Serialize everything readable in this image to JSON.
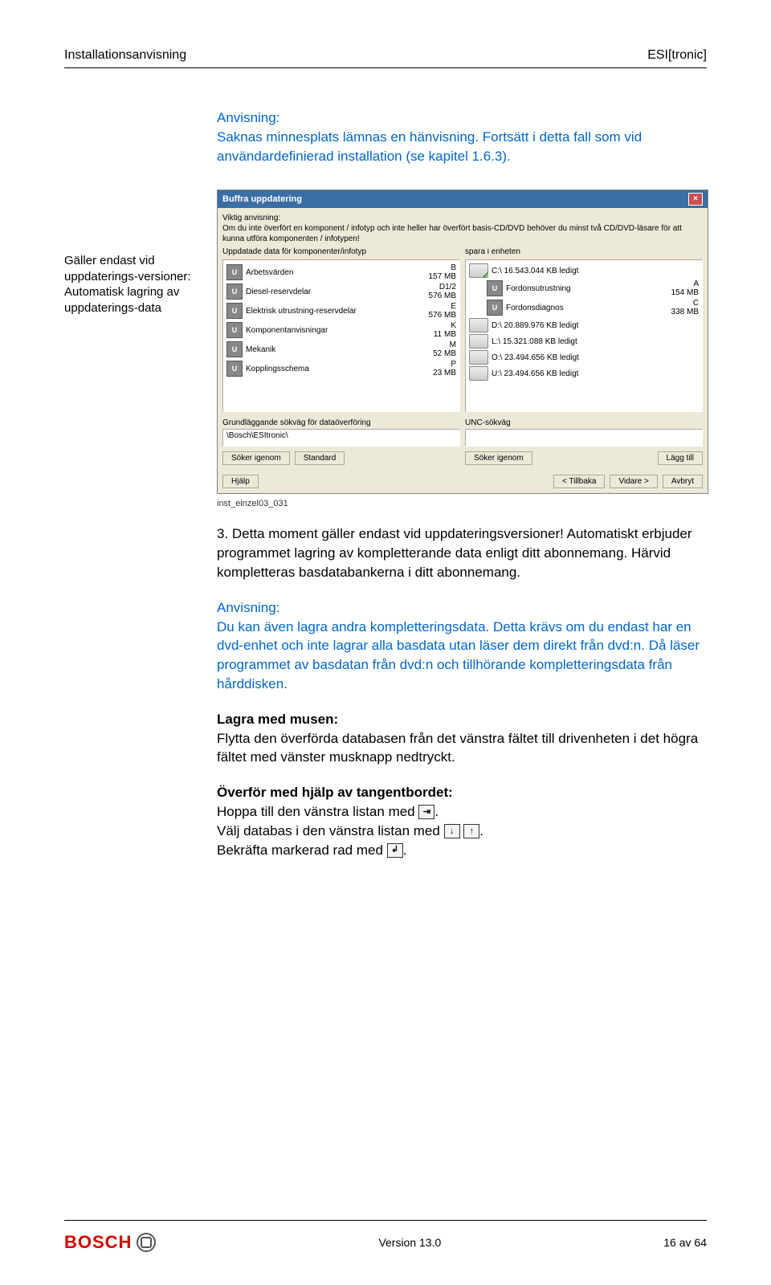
{
  "header": {
    "left": "Installationsanvisning",
    "right": "ESI[tronic]"
  },
  "intro": {
    "heading": "Anvisning:",
    "body": "Saknas minnesplats lämnas en hänvisning. Fortsätt i detta fall som vid användardefinierad installation (se kapitel 1.6.3)."
  },
  "sidenote": "Gäller endast vid uppdaterings-versioner: Automatisk lagring av uppdaterings-data",
  "dialog": {
    "title": "Buffra uppdatering",
    "intro_label": "Viktig anvisning:",
    "intro_body": "Om du inte överfört en komponent / infotyp och inte heller har överfört basis-CD/DVD behöver du minst två CD/DVD-läsare för att kunna utföra komponenten / infotypen!",
    "left_header": "Uppdatade data för komponenter/infotyp",
    "right_header": "spara i enheten",
    "left_items": [
      {
        "name": "Arbetsvärden",
        "code": "B",
        "size": "157 MB"
      },
      {
        "name": "Diesel-reservdelar",
        "code": "D1/2",
        "size": "576 MB"
      },
      {
        "name": "Elektrisk utrustning-reservdelar",
        "code": "E",
        "size": "576 MB"
      },
      {
        "name": "Komponentanvisningar",
        "code": "K",
        "size": "11 MB"
      },
      {
        "name": "Mekanik",
        "code": "M",
        "size": "52 MB"
      },
      {
        "name": "Kopplingsschema",
        "code": "P",
        "size": "23 MB"
      }
    ],
    "right_items": [
      {
        "label": "C:\\ 16.543.044 KB ledigt",
        "sub1": "Fordonsutrustning",
        "sub1code": "A",
        "sub1size": "154 MB",
        "sub2": "Fordonsdiagnos",
        "sub2code": "C",
        "sub2size": "338 MB"
      },
      {
        "label": "D:\\ 20.889.976 KB ledigt"
      },
      {
        "label": "L:\\ 15.321.088 KB ledigt"
      },
      {
        "label": "O:\\ 23.494.656 KB ledigt"
      },
      {
        "label": "U:\\ 23.494.656 KB ledigt"
      }
    ],
    "path_left_label": "Grundläggande sökväg för dataöverföring",
    "path_left_value": "\\Bosch\\ESItronic\\",
    "path_right_label": "UNC-sökväg",
    "path_right_value": "",
    "btn_search": "Söker igenom",
    "btn_standard": "Standard",
    "btn_add": "Lägg till",
    "btn_help": "Hjälp",
    "btn_back": "< Tillbaka",
    "btn_next": "Vidare >",
    "btn_cancel": "Avbryt"
  },
  "caption": "inst_einzel03_031",
  "step": "3. Detta moment gäller endast vid uppdateringsversioner! Automatiskt erbjuder programmet lagring av kompletterande data enligt ditt abonnemang. Härvid kompletteras basdatabankerna i ditt abonnemang.",
  "advice2": {
    "heading": "Anvisning:",
    "body": "Du kan även lagra andra kompletteringsdata. Detta krävs om du endast har en dvd-enhet och inte lagrar alla basdata utan läser dem direkt från dvd:n. Då läser programmet av basdatan från dvd:n och tillhörande kompletteringsdata från hårddisken."
  },
  "mouse": {
    "heading": "Lagra med musen:",
    "body": "Flytta den överförda databasen från det vänstra fältet till drivenheten i det högra fältet med vänster musknapp nedtryckt."
  },
  "keyboard": {
    "heading": "Överför med hjälp av tangentbordet:",
    "line1a": "Hoppa till den vänstra listan med ",
    "line1b": ".",
    "line2a": "Välj databas i den vänstra listan med ",
    "line2b": ".",
    "line3a": "Bekräfta markerad rad med ",
    "line3b": "."
  },
  "footer": {
    "logo": "BOSCH",
    "version": "Version 13.0",
    "page": "16 av 64"
  }
}
